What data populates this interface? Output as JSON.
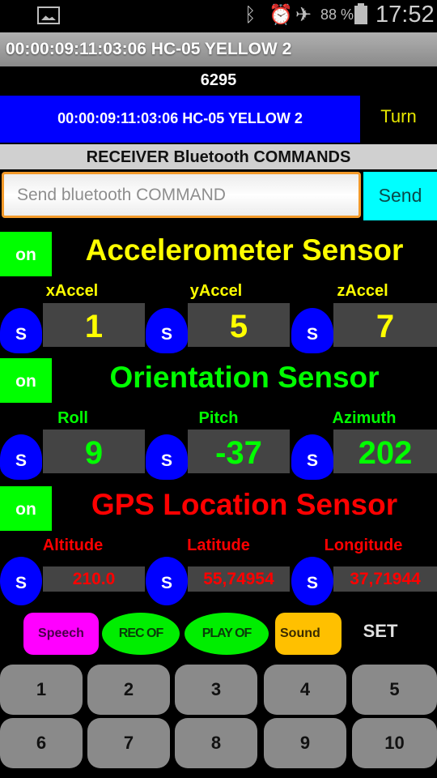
{
  "status_bar": {
    "icons": [
      "gallery-icon",
      "bluetooth-icon",
      "alarm-icon",
      "airplane-mode-icon",
      "battery-icon"
    ],
    "battery_percent": "88 %",
    "time": "17:52"
  },
  "title_bar": {
    "title": "00:00:09:11:03:06 HC-05 YELLOW 2"
  },
  "counter": "6295",
  "device_button": {
    "label": "00:00:09:11:03:06 HC-05 YELLOW 2",
    "color": "#0000ff"
  },
  "turn_button": {
    "label": "Turn"
  },
  "receiver_label": "RECEIVER Bluetooth COMMANDS",
  "command_input": {
    "placeholder": "Send bluetooth COMMAND",
    "value": ""
  },
  "send_button": {
    "label": "Send",
    "color": "#00ffff"
  },
  "sections": [
    {
      "toggle_label": "on",
      "title": "Accelerometer Sensor",
      "color": "#ffff00",
      "fields": [
        {
          "label": "xAccel",
          "button": "S",
          "value": "1"
        },
        {
          "label": "yAccel",
          "button": "S",
          "value": "5"
        },
        {
          "label": "zAccel",
          "button": "S",
          "value": "7"
        }
      ]
    },
    {
      "toggle_label": "on",
      "title": "Orientation Sensor",
      "color": "#00ff00",
      "fields": [
        {
          "label": "Roll",
          "button": "S",
          "value": "9"
        },
        {
          "label": "Pitch",
          "button": "S",
          "value": "-37"
        },
        {
          "label": "Azimuth",
          "button": "S",
          "value": "202"
        }
      ]
    },
    {
      "toggle_label": "on",
      "title": "GPS Location Sensor",
      "color": "#ff0000",
      "fields": [
        {
          "label": "Altitude",
          "button": "S",
          "value": "210.0"
        },
        {
          "label": "Latitude",
          "button": "S",
          "value": "55,74954"
        },
        {
          "label": "Longitude",
          "button": "S",
          "value": "37,71944"
        }
      ]
    }
  ],
  "controls": {
    "speech": "Speech",
    "rec": "REC OF",
    "play": "PLAY OF",
    "sound": "Sound",
    "set": "SET"
  },
  "keypad": [
    "1",
    "2",
    "3",
    "4",
    "5",
    "6",
    "7",
    "8",
    "9",
    "10"
  ]
}
